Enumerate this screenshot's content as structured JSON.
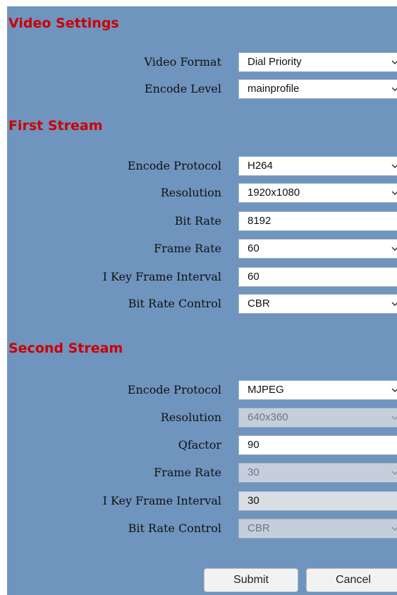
{
  "video_settings": {
    "title": "Video Settings",
    "video_format": {
      "label": "Video Format",
      "value": "Dial Priority"
    },
    "encode_level": {
      "label": "Encode Level",
      "value": "mainprofile"
    }
  },
  "first_stream": {
    "title": "First Stream",
    "encode_protocol": {
      "label": "Encode Protocol",
      "value": "H264"
    },
    "resolution": {
      "label": "Resolution",
      "value": "1920x1080"
    },
    "bit_rate": {
      "label": "Bit Rate",
      "value": "8192"
    },
    "frame_rate": {
      "label": "Frame Rate",
      "value": "60"
    },
    "i_key_frame_interval": {
      "label": "I Key Frame Interval",
      "value": "60"
    },
    "bit_rate_control": {
      "label": "Bit Rate Control",
      "value": "CBR"
    }
  },
  "second_stream": {
    "title": "Second Stream",
    "encode_protocol": {
      "label": "Encode Protocol",
      "value": "MJPEG"
    },
    "resolution": {
      "label": "Resolution",
      "value": "640x360"
    },
    "qfactor": {
      "label": "Qfactor",
      "value": "90"
    },
    "frame_rate": {
      "label": "Frame Rate",
      "value": "30"
    },
    "i_key_frame_interval": {
      "label": "I Key Frame Interval",
      "value": "30"
    },
    "bit_rate_control": {
      "label": "Bit Rate Control",
      "value": "CBR"
    }
  },
  "buttons": {
    "submit": "Submit",
    "cancel": "Cancel"
  },
  "colors": {
    "panel_bg": "#6f94be",
    "section_title": "#cc0000",
    "disabled_bg": "#c4cfdb"
  }
}
